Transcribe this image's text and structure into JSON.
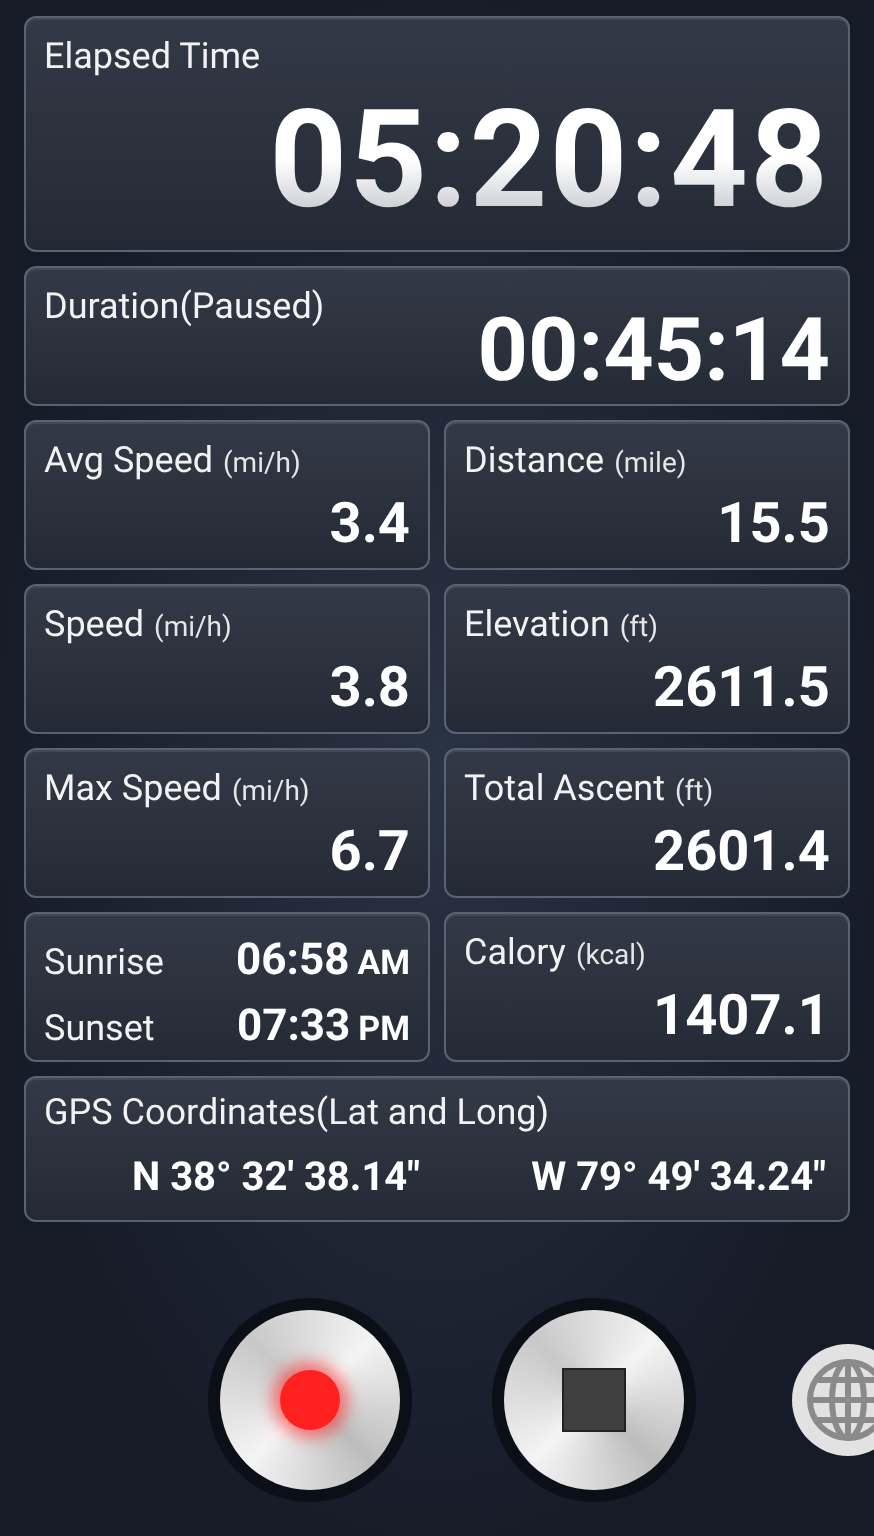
{
  "elapsed": {
    "label": "Elapsed Time",
    "value": "05:20:48"
  },
  "duration": {
    "label": "Duration(Paused)",
    "value": "00:45:14"
  },
  "stats": [
    {
      "kind": "metric",
      "label": "Avg Speed",
      "unit": "(mi/h)",
      "value": "3.4"
    },
    {
      "kind": "metric",
      "label": "Distance",
      "unit": "(mile)",
      "value": "15.5"
    },
    {
      "kind": "metric",
      "label": "Speed",
      "unit": "(mi/h)",
      "value": "3.8"
    },
    {
      "kind": "metric",
      "label": "Elevation",
      "unit": "(ft)",
      "value": "2611.5"
    },
    {
      "kind": "metric",
      "label": "Max Speed",
      "unit": "(mi/h)",
      "value": "6.7"
    },
    {
      "kind": "metric",
      "label": "Total Ascent",
      "unit": "(ft)",
      "value": "2601.4"
    },
    {
      "kind": "sun",
      "rows": [
        {
          "label": "Sunrise",
          "time": "06:58",
          "period": "AM"
        },
        {
          "label": "Sunset",
          "time": "07:33",
          "period": "PM"
        }
      ]
    },
    {
      "kind": "metric",
      "label": "Calory",
      "unit": "(kcal)",
      "value": "1407.1"
    }
  ],
  "gps": {
    "label": "GPS Coordinates(Lat and Long)",
    "lat": "N 38° 32' 38.14\"",
    "long": "W 79° 49' 34.24\""
  },
  "controls": [
    {
      "kind": "record"
    },
    {
      "kind": "stop"
    },
    {
      "kind": "globe"
    }
  ]
}
